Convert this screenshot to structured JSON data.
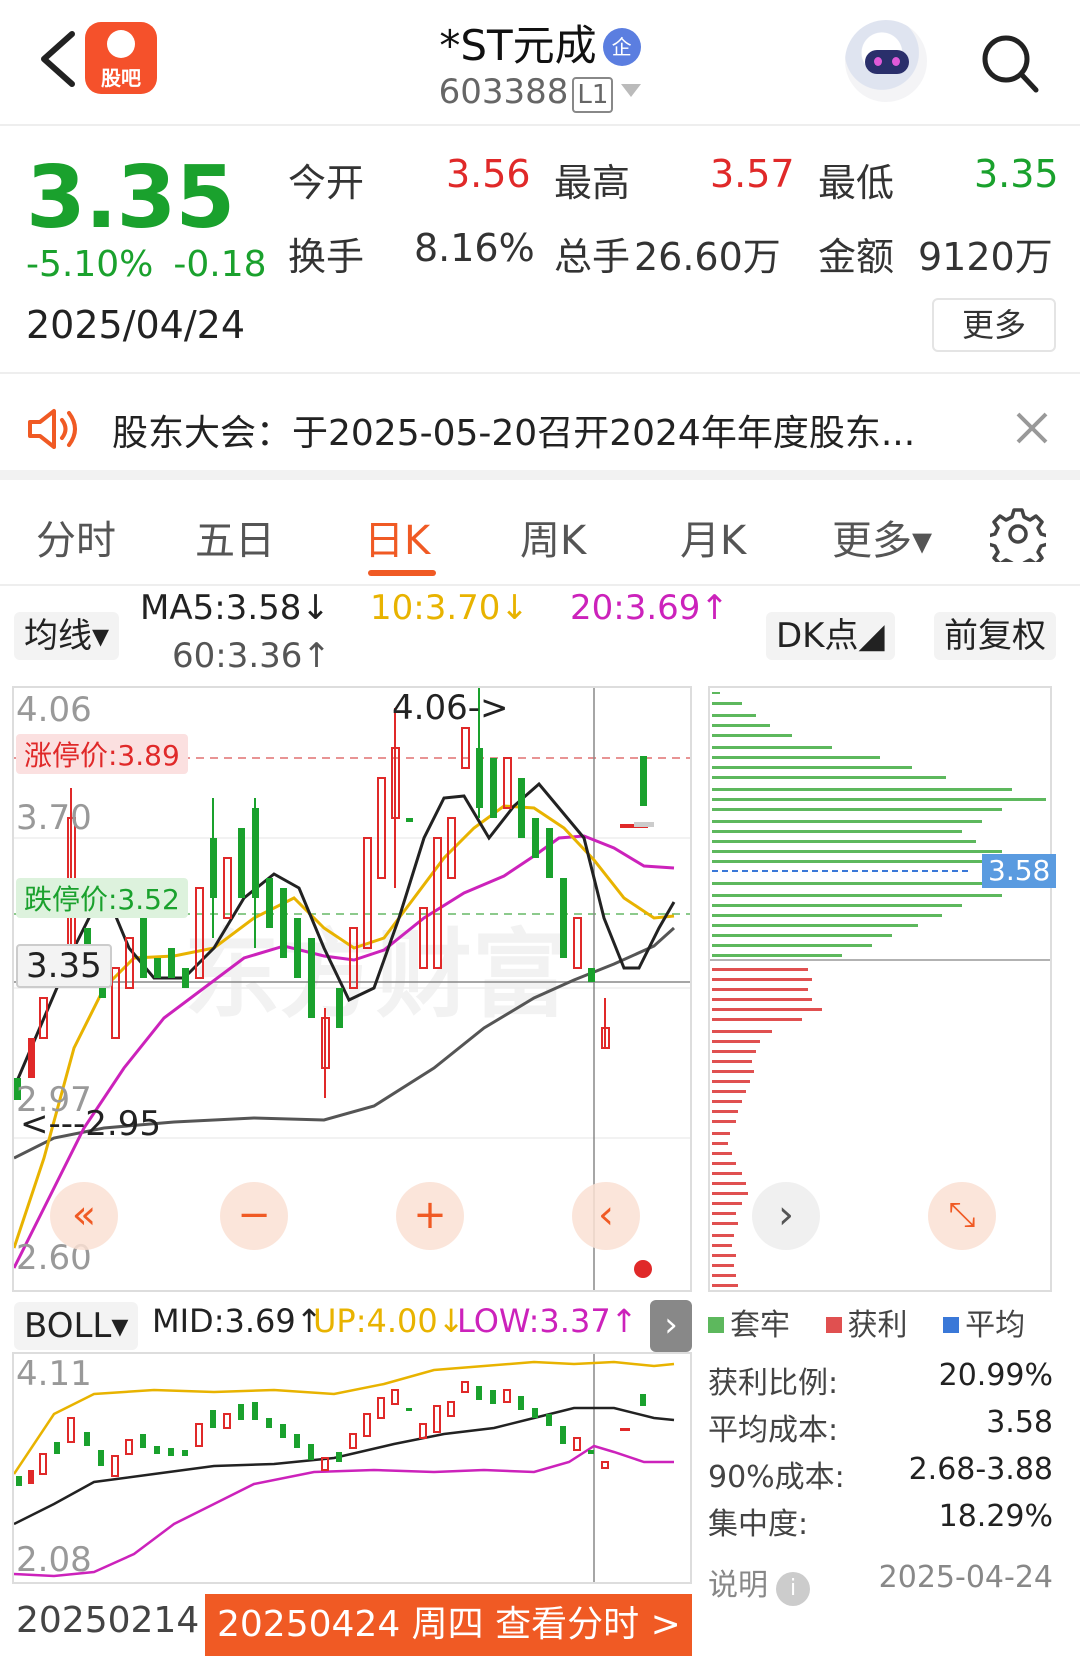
{
  "header": {
    "logo_text": "股吧",
    "stock_name": "*ST元成",
    "badge": "企",
    "code": "603388",
    "level": "L1"
  },
  "quote": {
    "price": "3.35",
    "change_pct": "-5.10%",
    "change_abs": "-0.18",
    "date": "2025/04/24",
    "open_label": "今开",
    "open": "3.56",
    "high_label": "最高",
    "high": "3.57",
    "low_label": "最低",
    "low": "3.35",
    "turnover_label": "换手",
    "turnover": "8.16%",
    "volume_label": "总手",
    "volume": "26.60万",
    "amount_label": "金额",
    "amount": "9120万",
    "more": "更多"
  },
  "notice": {
    "text": "股东大会：于2025-05-20召开2024年年度股东..."
  },
  "tabs": [
    "分时",
    "五日",
    "日K",
    "周K",
    "月K",
    "更多▾"
  ],
  "ma": {
    "selector": "均线▾",
    "ma5": "MA5:3.58↓",
    "ma10": "10:3.70↓",
    "ma20": "20:3.69↑",
    "ma60": "60:3.36↑",
    "dk": "DK点◢",
    "adjust": "前复权",
    "colors": {
      "ma5": "#222222",
      "ma10": "#e8b300",
      "ma20": "#cc22bb",
      "ma60": "#555555"
    }
  },
  "chart_labels": {
    "y_top": "4.06",
    "limit_up": "涨停价:3.89",
    "y_mid": "3.70",
    "limit_down": "跌停价:3.52",
    "y_cur": "3.35",
    "y_low": "2.97",
    "y_bottom": "2.60",
    "peak": "4.06->",
    "trough": "<---2.95",
    "vp_avg": "3.58"
  },
  "boll": {
    "selector": "BOLL▾",
    "mid": "MID:3.69↑",
    "up": "UP:4.00↓",
    "low": "LOW:3.37↑",
    "y_top": "4.11",
    "y_bottom": "2.08"
  },
  "bottom": {
    "start_date": "20250214",
    "current": "20250424 周四 查看分时 >"
  },
  "chip": {
    "legend": [
      "套牢",
      "获利",
      "平均"
    ],
    "profit_ratio_label": "获利比例:",
    "profit_ratio": "20.99%",
    "avg_cost_label": "平均成本:",
    "avg_cost": "3.58",
    "cost90_label": "90%成本:",
    "cost90": "2.68-3.88",
    "concentration_label": "集中度:",
    "concentration": "18.29%",
    "explain_label": "说明",
    "explain_date": "2025-04-24"
  }
}
